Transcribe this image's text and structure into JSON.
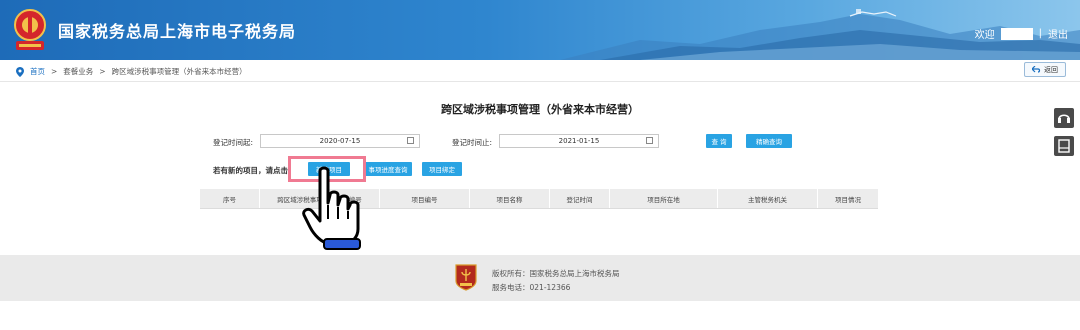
{
  "header": {
    "site_title": "国家税务总局上海市电子税务局",
    "welcome_label": "欢迎",
    "divider": "|",
    "logout_label": "退出"
  },
  "breadcrumb": {
    "home": "首页",
    "separator": ">",
    "level1": "套餐业务",
    "level2": "跨区域涉税事项管理（外省来本市经营）",
    "back_label": "返回"
  },
  "main": {
    "title": "跨区域涉税事项管理（外省来本市经营）",
    "register_from_label": "登记时间起:",
    "register_from_value": "2020-07-15",
    "register_to_label": "登记时间止:",
    "register_to_value": "2021-01-15",
    "query_button": "查 询",
    "exact_query_button": "精确查询",
    "new_project_prompt": "若有新的项目，请点击：",
    "new_project_button": "新建项目",
    "progress_query_button": "事项进度查询",
    "project_bind_button": "项目绑定"
  },
  "table": {
    "columns": [
      "序号",
      "跨区域涉税事项报验管理编号",
      "项目编号",
      "项目名称",
      "登记时间",
      "项目所在地",
      "主管税务机关",
      "项目情况"
    ]
  },
  "footer": {
    "copyright": "版权所有：国家税务总局上海市税务局",
    "phone": "服务电话：021-12366"
  },
  "colors": {
    "header_blue": "#1e6bb8",
    "button_blue": "#29a3e3",
    "highlight_pink": "#f07a92",
    "footer_gray": "#eaeaea"
  },
  "icons": {
    "emblem": "tax-emblem-icon",
    "home": "location-pin-icon",
    "back": "return-arrow-icon",
    "side1": "headset-icon",
    "side2": "document-icon",
    "cursor": "hand-pointer-icon"
  }
}
